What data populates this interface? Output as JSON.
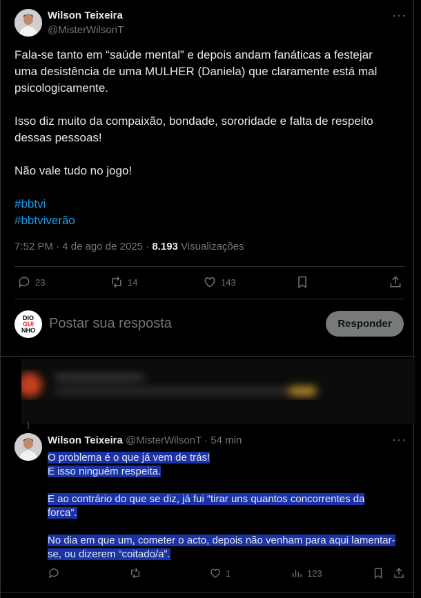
{
  "tweet": {
    "author_name": "Wilson Teixeira",
    "author_handle": "@MisterWilsonT",
    "paragraphs": [
      [
        "Fala-se tanto em “saúde mental” e depois andam fanáticas a festejar",
        "uma desistência de uma MULHER (Daniela) que claramente está mal",
        "psicologicamente."
      ],
      [
        "Isso diz muito da compaixão, bondade, sororidade e falta de respeito",
        "dessas pessoas!"
      ],
      [
        "Não vale tudo no jogo!"
      ]
    ],
    "hashtags": [
      "#bbtvi",
      "#bbtviverão"
    ],
    "time": "7:52 PM",
    "date": "4 de ago de 2025",
    "views_count": "8.193",
    "views_label": "Visualizações",
    "replies": "23",
    "retweets": "14",
    "likes": "143"
  },
  "reply_box": {
    "placeholder": "Postar sua resposta",
    "button_label": "Responder",
    "avatar_lines": [
      "DIO",
      "GUI",
      "NHO"
    ]
  },
  "reply": {
    "author_name": "Wilson Teixeira",
    "author_handle": "@MisterWilsonT",
    "time_ago": "54 min",
    "lines": [
      "O problema é o que já vem de trás!",
      "E isso ninguém respeita.",
      "",
      "E ao contrário do que se diz, já fui “tirar uns quantos concorrentes da",
      "forca”.",
      "",
      "No dia em que um, cometer o acto, depois não venham para aqui lamentar-",
      "se, ou dizerem “coitado/a”."
    ],
    "likes": "1",
    "views": "123"
  },
  "colors": {
    "background": "#000000",
    "link": "#1d9bf0",
    "selection": "#1a34a8",
    "muted": "#71767b"
  }
}
